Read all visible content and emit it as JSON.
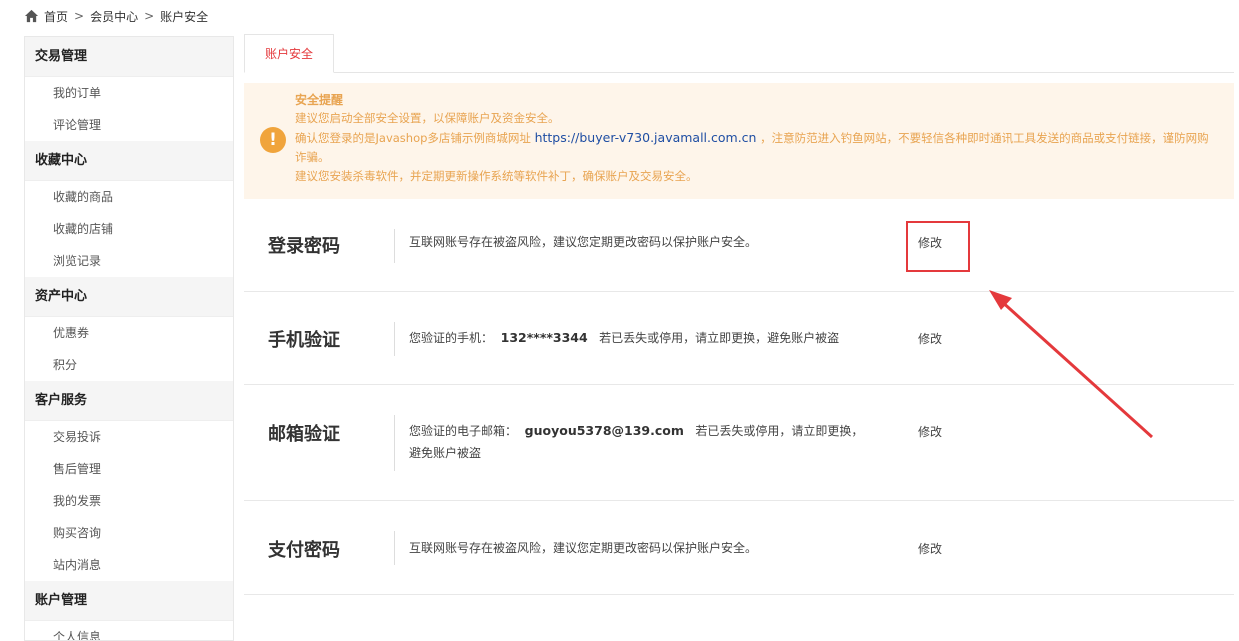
{
  "breadcrumb": {
    "home": "首页",
    "sep1": ">",
    "member": "会员中心",
    "sep2": ">",
    "current": "账户安全"
  },
  "sidebar": {
    "groups": [
      {
        "title": "交易管理",
        "items": [
          "我的订单",
          "评论管理"
        ]
      },
      {
        "title": "收藏中心",
        "items": [
          "收藏的商品",
          "收藏的店铺",
          "浏览记录"
        ]
      },
      {
        "title": "资产中心",
        "items": [
          "优惠券",
          "积分"
        ]
      },
      {
        "title": "客户服务",
        "items": [
          "交易投诉",
          "售后管理",
          "我的发票",
          "购买咨询",
          "站内消息"
        ]
      },
      {
        "title": "账户管理",
        "items": [
          "个人信息"
        ]
      }
    ]
  },
  "tab": {
    "label": "账户安全"
  },
  "notice": {
    "icon": "exclamation-icon",
    "title": "安全提醒",
    "line1": "建议您启动全部安全设置，以保障账户及资金安全。",
    "line2_prefix": "确认您登录的是Javashop多店铺示例商城网址",
    "url": "https://buyer-v730.javamall.com.cn",
    "line2_suffix": "，注意防范进入钓鱼网站，不要轻信各种即时通讯工具发送的商品或支付链接，谨防网购诈骗。",
    "line3": "建议您安装杀毒软件，并定期更新操作系统等软件补丁，确保账户及交易安全。",
    "accent_color": "#e8a451"
  },
  "security": {
    "login": {
      "label": "登录密码",
      "desc": "互联网账号存在被盗风险，建议您定期更改密码以保护账户安全。",
      "action": "修改"
    },
    "phone": {
      "label": "手机验证",
      "desc_prefix": "您验证的手机：",
      "value": "132****3344",
      "desc_suffix": "若已丢失或停用，请立即更换，避免账户被盗",
      "action": "修改"
    },
    "email": {
      "label": "邮箱验证",
      "desc_prefix": "您验证的电子邮箱：",
      "value": "guoyou5378@139.com",
      "desc_suffix": "若已丢失或停用，请立即更换，避免账户被盗",
      "action": "修改"
    },
    "pay": {
      "label": "支付密码",
      "desc": "互联网账号存在被盗风险，建议您定期更改密码以保护账户安全。",
      "action": "修改"
    }
  },
  "annotation_color": "#e4393c"
}
